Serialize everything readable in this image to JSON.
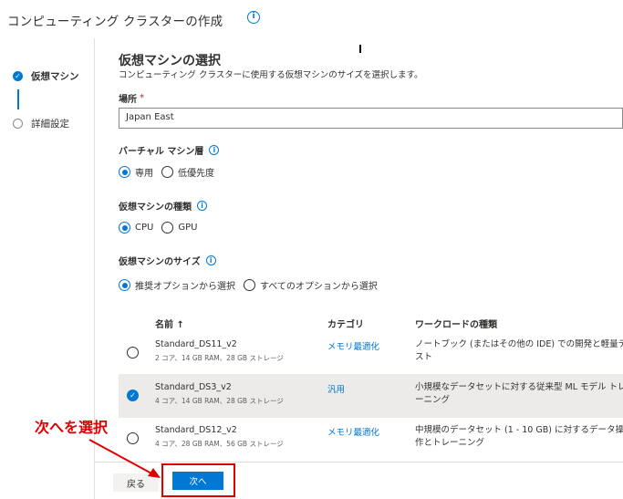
{
  "header": {
    "title": "コンピューティング クラスターの作成",
    "info_icon": "info-icon"
  },
  "stepper": {
    "steps": [
      {
        "label": "仮想マシン",
        "state": "done"
      },
      {
        "label": "詳細設定",
        "state": "todo"
      }
    ]
  },
  "section": {
    "title": "仮想マシンの選択",
    "subtitle": "コンピューティング クラスターに使用する仮想マシンのサイズを選択します。"
  },
  "location": {
    "label": "場所",
    "required_mark": "*",
    "value": "Japan East"
  },
  "vm_tier": {
    "label": "バーチャル マシン層",
    "options": [
      "専用",
      "低優先度"
    ],
    "selected": "専用"
  },
  "vm_type": {
    "label": "仮想マシンの種類",
    "options": [
      "CPU",
      "GPU"
    ],
    "selected": "CPU"
  },
  "vm_size": {
    "label": "仮想マシンのサイズ",
    "options": [
      "推奨オプションから選択",
      "すべてのオプションから選択"
    ],
    "selected": "推奨オプションから選択"
  },
  "table": {
    "columns": [
      "名前 ↑",
      "カテゴリ",
      "ワークロードの種類"
    ],
    "rows": [
      {
        "name": "Standard_DS11_v2",
        "spec": "2 コア、14 GB RAM、28 GB ストレージ",
        "category": "メモリ最適化",
        "workload": "ノートブック (またはその他の IDE) での開発と軽量テスト",
        "selected": false
      },
      {
        "name": "Standard_DS3_v2",
        "spec": "4 コア、14 GB RAM、28 GB ストレージ",
        "category": "汎用",
        "workload": "小規模なデータセットに対する従来型 ML モデル トレーニング",
        "selected": true
      },
      {
        "name": "Standard_DS12_v2",
        "spec": "4 コア、28 GB RAM、56 GB ストレージ",
        "category": "メモリ最適化",
        "workload": "中規模のデータセット (1 - 10 GB) に対するデータ操作とトレーニング",
        "selected": false
      }
    ]
  },
  "footer": {
    "back_label": "戻る",
    "next_label": "次へ"
  },
  "annotation": {
    "text": "次へを選択",
    "color": "#e00000"
  },
  "colors": {
    "accent": "#0078d4",
    "annotation": "#e00000"
  }
}
